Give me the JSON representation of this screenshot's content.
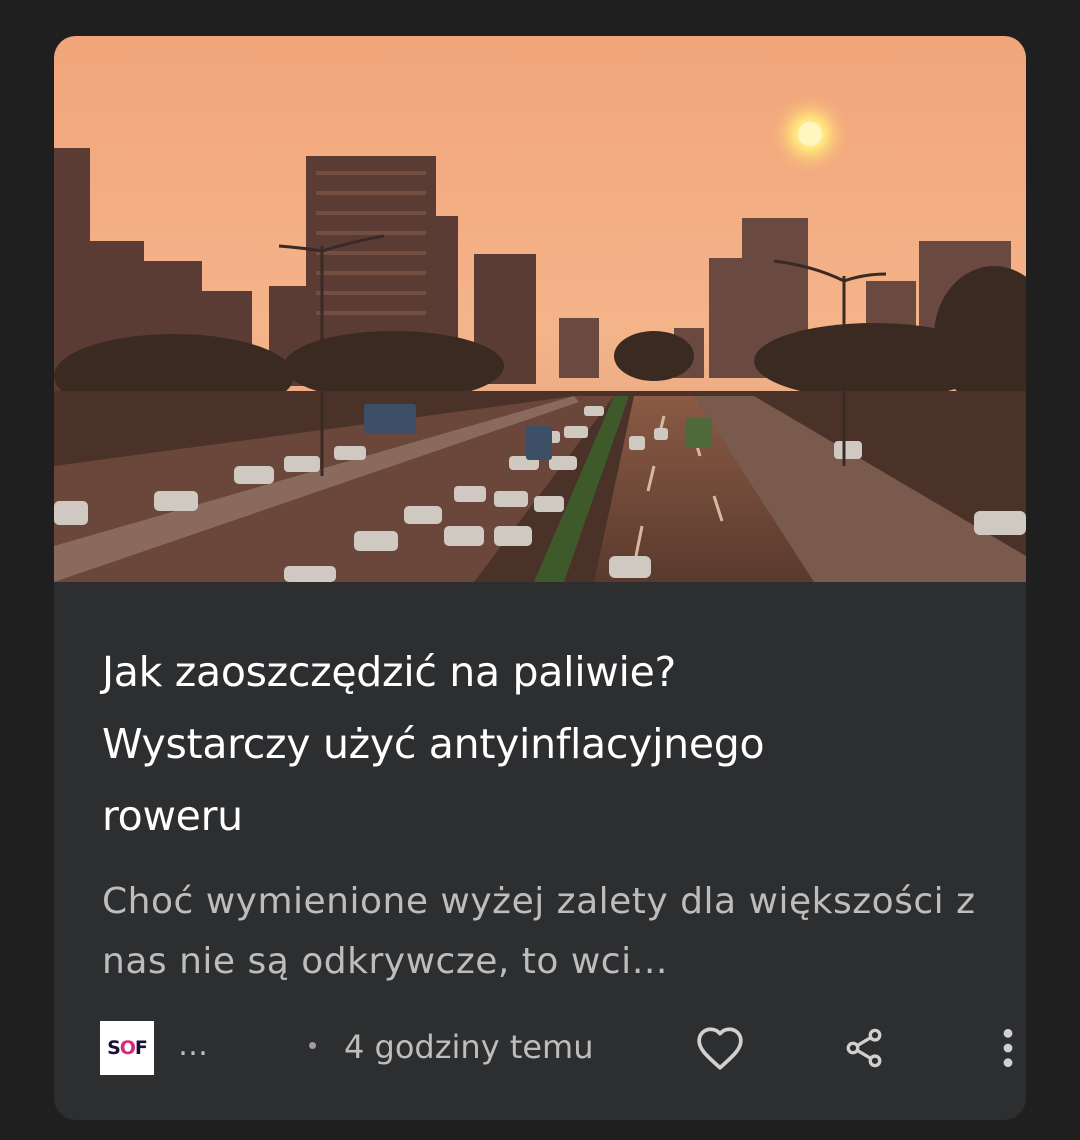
{
  "article": {
    "title_line1": "Jak zaoszczędzić na paliwie?",
    "title_line2": "Wystarczy użyć antyinflacyjnego",
    "title_line3": "roweru",
    "snippet": "Choć wymienione wyżej zalety dla większości z nas nie są odkrywcze, to wci…"
  },
  "footer": {
    "logo_part1": "S",
    "logo_part2": "O",
    "logo_part3": "F",
    "source": "…",
    "separator": "•",
    "time": "4 godziny temu"
  },
  "icons": {
    "like": "heart-icon",
    "share": "share-icon",
    "more": "more-vert-icon"
  },
  "colors": {
    "background": "#1f1f1f",
    "card": "#2d2e30",
    "title": "#ffffff",
    "secondary_text": "#bdbdbd"
  }
}
